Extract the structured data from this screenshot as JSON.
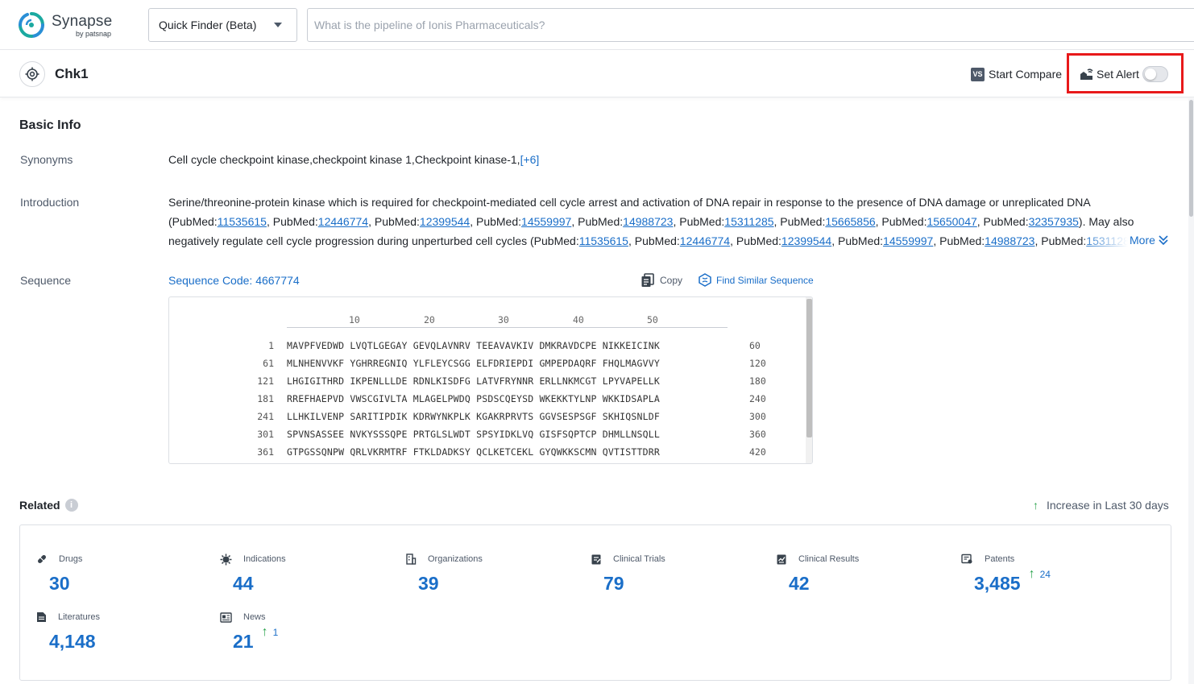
{
  "header": {
    "logo_text": "Synapse",
    "logo_sub": "by patsnap",
    "finder_label": "Quick Finder (Beta)",
    "search_placeholder": "What is the pipeline of Ionis Pharmaceuticals?"
  },
  "titlebar": {
    "title": "Chk1",
    "compare_label": "Start Compare",
    "compare_icon": "VS",
    "alert_label": "Set Alert"
  },
  "basic_info": {
    "title": "Basic Info",
    "synonyms_label": "Synonyms",
    "synonyms_value": "Cell cycle checkpoint kinase,checkpoint kinase 1,Checkpoint kinase-1,",
    "synonyms_more": "[+6]",
    "intro_label": "Introduction",
    "intro_line1": "Serine/threonine-protein kinase which is required for checkpoint-mediated cell cycle arrest and activation of DNA repair in response to the presence of DNA damage or unreplicated DNA",
    "intro_line2": [
      {
        "t": "(PubMed:",
        "l": false
      },
      {
        "t": "11535615",
        "l": true
      },
      {
        "t": ", PubMed:",
        "l": false
      },
      {
        "t": "12446774",
        "l": true
      },
      {
        "t": ", PubMed:",
        "l": false
      },
      {
        "t": "12399544",
        "l": true
      },
      {
        "t": ", PubMed:",
        "l": false
      },
      {
        "t": "14559997",
        "l": true
      },
      {
        "t": ", PubMed:",
        "l": false
      },
      {
        "t": "14988723",
        "l": true
      },
      {
        "t": ", PubMed:",
        "l": false
      },
      {
        "t": "15311285",
        "l": true
      },
      {
        "t": ", PubMed:",
        "l": false
      },
      {
        "t": "15665856",
        "l": true
      },
      {
        "t": ", PubMed:",
        "l": false
      },
      {
        "t": "15650047",
        "l": true
      },
      {
        "t": ", PubMed:",
        "l": false
      },
      {
        "t": "32357935",
        "l": true
      },
      {
        "t": "). May also",
        "l": false
      }
    ],
    "intro_line3": [
      {
        "t": "negatively regulate cell cycle progression during unperturbed cell cycles (PubMed:",
        "l": false
      },
      {
        "t": "11535615",
        "l": true
      },
      {
        "t": ", PubMed:",
        "l": false
      },
      {
        "t": "12446774",
        "l": true
      },
      {
        "t": ", PubMed:",
        "l": false
      },
      {
        "t": "12399544",
        "l": true
      },
      {
        "t": ", PubMed:",
        "l": false
      },
      {
        "t": "14559997",
        "l": true
      },
      {
        "t": ", PubMed:",
        "l": false
      },
      {
        "t": "14988723",
        "l": true
      },
      {
        "t": ", PubMed:",
        "l": false
      },
      {
        "t": "15311285",
        "l": true
      }
    ],
    "more_label": "More",
    "sequence_label": "Sequence",
    "sequence_code": "Sequence Code: 4667774",
    "copy_label": "Copy",
    "find_similar_label": "Find Similar Sequence"
  },
  "sequence": {
    "ruler": [
      "10",
      "20",
      "30",
      "40",
      "50"
    ],
    "rows": [
      {
        "start": "1",
        "residues": "MAVPFVEDWD LVQTLGEGAY GEVQLAVNRV TEEAVAVKIV DMKRAVDCPE NIKKEICINK",
        "end": "60"
      },
      {
        "start": "61",
        "residues": "MLNHENVVKF YGHRREGNIQ YLFLEYCSGG ELFDRIEPDI GMPEPDAQRF FHQLMAGVVY",
        "end": "120"
      },
      {
        "start": "121",
        "residues": "LHGIGITHRD IKPENLLLDE RDNLKISDFG LATVFRYNNR ERLLNKMCGT LPYVAPELLK",
        "end": "180"
      },
      {
        "start": "181",
        "residues": "RREFHAEPVD VWSCGIVLTA MLAGELPWDQ PSDSCQEYSD WKEKKTYLNP WKKIDSAPLA",
        "end": "240"
      },
      {
        "start": "241",
        "residues": "LLHKILVENP SARITIPDIK KDRWYNKPLK KGAKRPRVTS GGVSESPSGF SKHIQSNLDF",
        "end": "300"
      },
      {
        "start": "301",
        "residues": "SPVNSASSEE NVKYSSSQPE PRTGLSLWDT SPSYIDKLVQ GISFSQPTCP DHMLLNSQLL",
        "end": "360"
      },
      {
        "start": "361",
        "residues": "GTPGSSQNPW QRLVKRMTRF FTKLDADKSY QCLKETCEKL GYQWKKSCMN QVTISTTDRR",
        "end": "420"
      }
    ]
  },
  "related": {
    "title": "Related",
    "info_icon": "i",
    "increase_note": "Increase in Last 30 days",
    "stats": [
      {
        "label": "Drugs",
        "value": "30",
        "inc": "",
        "icon": "pill-icon"
      },
      {
        "label": "Indications",
        "value": "44",
        "inc": "",
        "icon": "virus-icon"
      },
      {
        "label": "Organizations",
        "value": "39",
        "inc": "",
        "icon": "building-icon"
      },
      {
        "label": "Clinical Trials",
        "value": "79",
        "inc": "",
        "icon": "clipboard-icon"
      },
      {
        "label": "Clinical Results",
        "value": "42",
        "inc": "",
        "icon": "chart-doc-icon"
      },
      {
        "label": "Patents",
        "value": "3,485",
        "inc": "24",
        "icon": "patent-icon"
      },
      {
        "label": "Literatures",
        "value": "4,148",
        "inc": "",
        "icon": "document-icon"
      },
      {
        "label": "News",
        "value": "21",
        "inc": "1",
        "icon": "newspaper-icon"
      }
    ]
  },
  "colors": {
    "accent": "#1a6ec8",
    "increase": "#2da44e",
    "highlight_box": "#e8191a"
  }
}
